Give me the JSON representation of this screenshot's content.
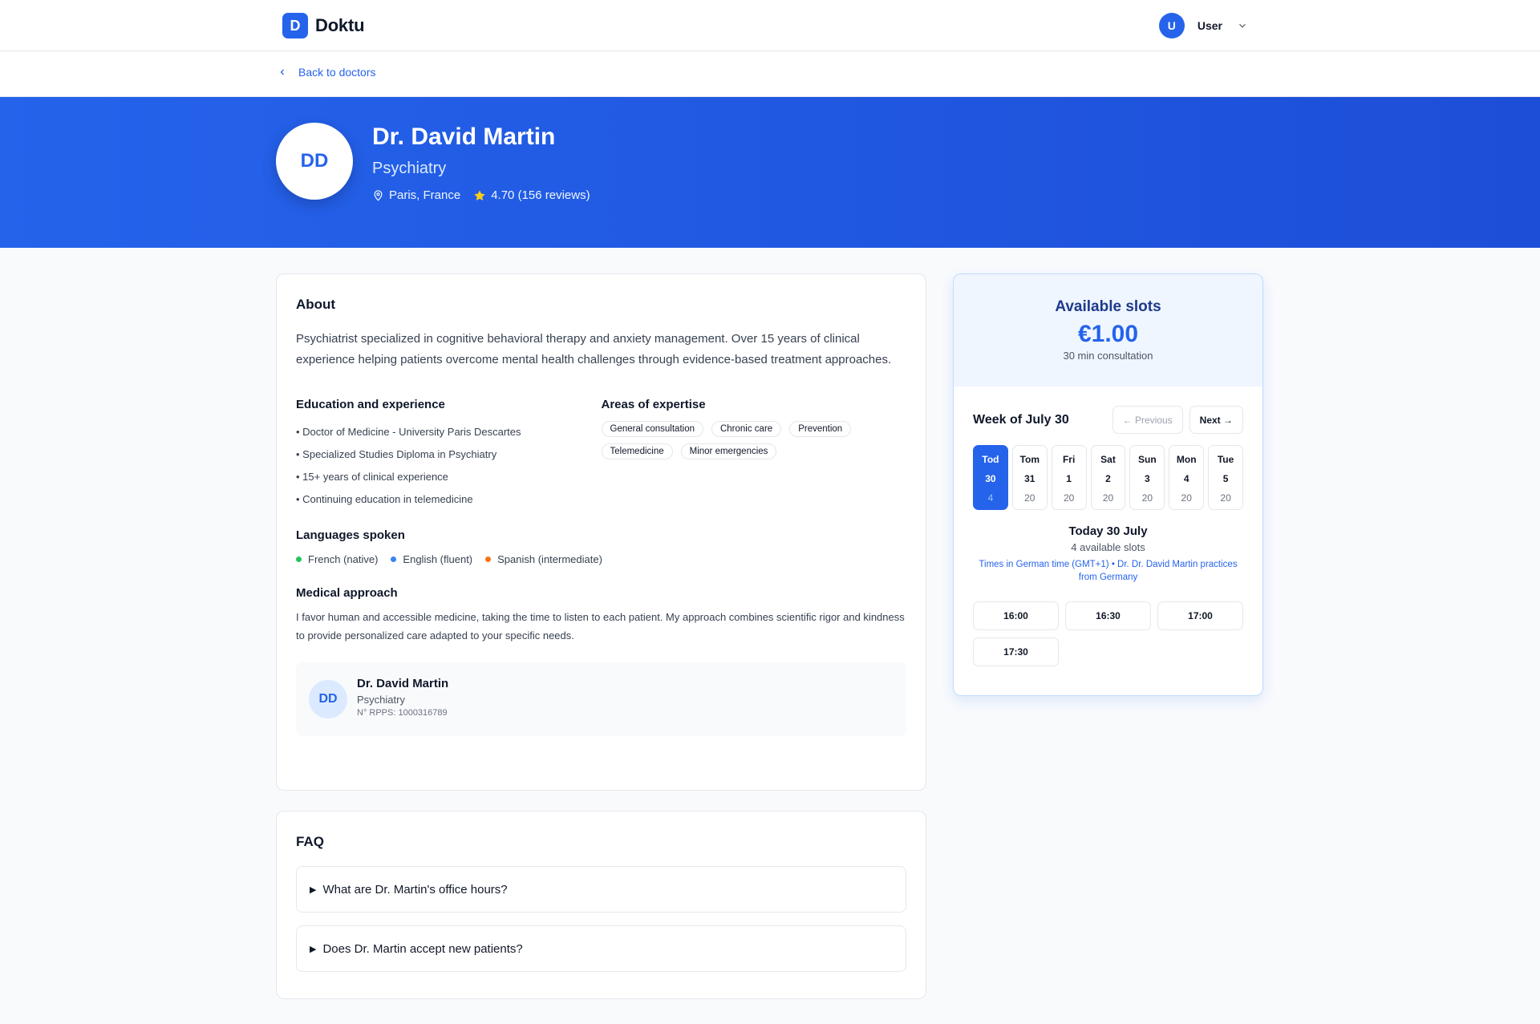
{
  "brand": {
    "logo_letter": "D",
    "name": "Doktu"
  },
  "user": {
    "initial": "U",
    "name": "User"
  },
  "back_link": "Back to doctors",
  "doctor": {
    "initials": "DD",
    "name": "Dr. David Martin",
    "specialty": "Psychiatry",
    "location": "Paris, France",
    "rating": "4.70 (156 reviews)"
  },
  "about": {
    "title": "About",
    "text": "Psychiatrist specialized in cognitive behavioral therapy and anxiety management. Over 15 years of clinical experience helping patients overcome mental health challenges through evidence-based treatment approaches.",
    "education_title": "Education and experience",
    "education": [
      "• Doctor of Medicine - University Paris Descartes",
      "• Specialized Studies Diploma in Psychiatry",
      "• 15+ years of clinical experience",
      "• Continuing education in telemedicine"
    ],
    "expertise_title": "Areas of expertise",
    "expertise": [
      "General consultation",
      "Chronic care",
      "Prevention",
      "Telemedicine",
      "Minor emergencies"
    ],
    "languages_title": "Languages spoken",
    "languages": [
      {
        "label": "French (native)",
        "color": "#22c55e"
      },
      {
        "label": "English (fluent)",
        "color": "#3b82f6"
      },
      {
        "label": "Spanish (intermediate)",
        "color": "#f97316"
      }
    ],
    "approach_title": "Medical approach",
    "approach_text": "I favor human and accessible medicine, taking the time to listen to each patient. My approach combines scientific rigor and kindness to provide personalized care adapted to your specific needs.",
    "card": {
      "initials": "DD",
      "name": "Dr. David Martin",
      "specialty": "Psychiatry",
      "rpps": "N° RPPS: 1000316789"
    }
  },
  "faq": {
    "title": "FAQ",
    "items": [
      "What are Dr. Martin's office hours?",
      "Does Dr. Martin accept new patients?"
    ]
  },
  "booking": {
    "title": "Available slots",
    "price": "€1.00",
    "duration": "30 min consultation",
    "week_label": "Week of July 30",
    "prev_label": "← Previous",
    "next_label": "Next →",
    "days": [
      {
        "name": "Tod",
        "date": "30",
        "count": "4",
        "active": true
      },
      {
        "name": "Tom",
        "date": "31",
        "count": "20"
      },
      {
        "name": "Fri",
        "date": "1",
        "count": "20"
      },
      {
        "name": "Sat",
        "date": "2",
        "count": "20"
      },
      {
        "name": "Sun",
        "date": "3",
        "count": "20"
      },
      {
        "name": "Mon",
        "date": "4",
        "count": "20"
      },
      {
        "name": "Tue",
        "date": "5",
        "count": "20"
      }
    ],
    "selected_date": "Today 30 July",
    "selected_count": "4 available slots",
    "timezone_note": "Times in German time (GMT+1) • Dr. Dr. David Martin practices from Germany",
    "times": [
      "16:00",
      "16:30",
      "17:00",
      "17:30"
    ]
  },
  "colors": {
    "primary": "#2563eb",
    "hero_end": "#1d4ed8",
    "star": "#facc15"
  }
}
